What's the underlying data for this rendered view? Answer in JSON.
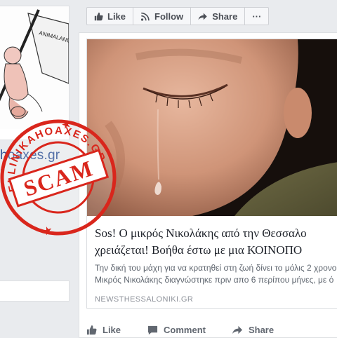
{
  "left_column": {
    "page_name": "hoaxes.gr",
    "page_handle": "r",
    "profile_caption": "ANIMALANDIKIAL"
  },
  "stamp": {
    "main_text": "SCAM",
    "ring_text": "ELLINIKAHOAXES.GR",
    "color": "#d9261c"
  },
  "action_bar": {
    "like_label": "Like",
    "follow_label": "Follow",
    "share_label": "Share",
    "more_label": "···"
  },
  "post": {
    "headline_line1": "Sos! Ο μικρός Νικολάκης από την Θεσσαλο",
    "headline_line2": "χρειάζεται! Βοήθα έστω με μια ΚΟΙΝΟΠΟ",
    "description_line1": "Την δική του μάχη για να κρατηθεί στη ζωή δίνει το μόλις 2 χρονο",
    "description_line2": "Μικρός Νικολάκης διαγνώστηκε πριν απο 6 περίπου μήνες, με ό",
    "domain": "NEWSTHESSALONIKI.GR",
    "actions": {
      "like": "Like",
      "comment": "Comment",
      "share": "Share"
    }
  },
  "colors": {
    "link": "#365899",
    "muted": "#90949c",
    "background": "#e9ebee"
  }
}
